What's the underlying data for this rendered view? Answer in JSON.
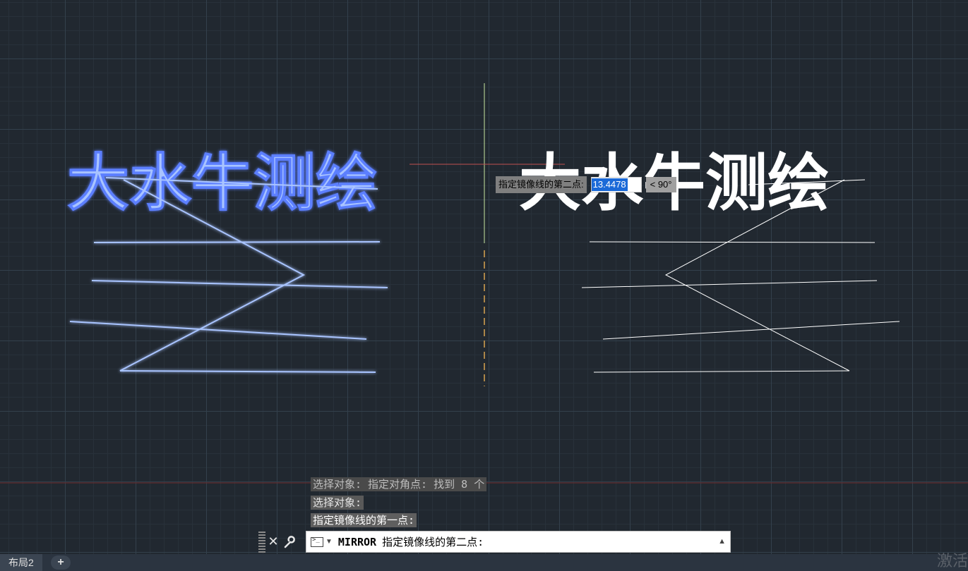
{
  "drawing": {
    "text_left": "大水牛测绘",
    "text_right": "大水牛测绘"
  },
  "dynamic_input": {
    "prompt": "指定镜像线的第二点:",
    "value": "13.4478",
    "angle": "< 90°"
  },
  "command_history": [
    "选择对象: 指定对角点: 找到 8 个",
    "选择对象:",
    "指定镜像线的第一点:"
  ],
  "command_line": {
    "command": "MIRROR",
    "prompt": "指定镜像线的第二点:"
  },
  "layout_tabs": {
    "active_tab": "布局2",
    "add_label": "+"
  },
  "watermark": "激活",
  "colors": {
    "background": "#212830",
    "selected": "#a9c4ff",
    "mirror_axis": "#d7a24f",
    "cursor_line": "#c8e6a0"
  }
}
